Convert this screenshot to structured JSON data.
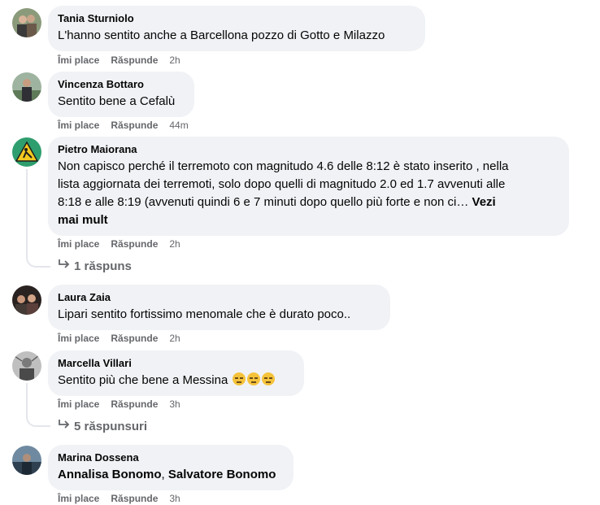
{
  "comments": [
    {
      "author": "Tania Sturniolo",
      "text": "L'hanno sentito anche a Barcellona pozzo di Gotto e Milazzo",
      "like": "Îmi place",
      "reply": "Răspunde",
      "time": "2h"
    },
    {
      "author": "Vincenza Bottaro",
      "text": "Sentito bene a Cefalù",
      "like": "Îmi place",
      "reply": "Răspunde",
      "time": "44m"
    },
    {
      "author": "Pietro Maiorana",
      "text_line1": "Non capisco perché il terremoto con magnitudo 4.6 delle 8:12 è stato inserito , nella",
      "text_line2": "lista aggiornata dei terremoti, solo dopo quelli di magnitudo 2.0 ed 1.7 avvenuti alle",
      "text_line3": "8:18 e alle 8:19 (avvenuti quindi 6 e 7 minuti dopo quello più forte e non ci…",
      "see_more_1": "Vezi",
      "see_more_2": "mai mult",
      "like": "Îmi place",
      "reply": "Răspunde",
      "time": "2h",
      "replies": "1 răspuns"
    },
    {
      "author": "Laura Zaia",
      "text": "Lipari sentito fortissimo menomale che è durato poco..",
      "like": "Îmi place",
      "reply": "Răspunde",
      "time": "2h"
    },
    {
      "author": "Marcella Villari",
      "text": "Sentito più che bene a Messina",
      "emojis": [
        "expressionless-face",
        "expressionless-face",
        "expressionless-face"
      ],
      "like": "Îmi place",
      "reply": "Răspunde",
      "time": "3h",
      "replies": "5 răspunsuri"
    },
    {
      "author": "Marina Dossena",
      "mention1": "Annalisa Bonomo",
      "separator": ",",
      "mention2": "Salvatore Bonomo",
      "like": "Îmi place",
      "reply": "Răspunde",
      "time": "3h"
    }
  ],
  "colors": {
    "bubble": "#f0f2f5",
    "secondary_text": "#65676b",
    "primary_text": "#050505",
    "thread_line": "#e4e6eb"
  }
}
